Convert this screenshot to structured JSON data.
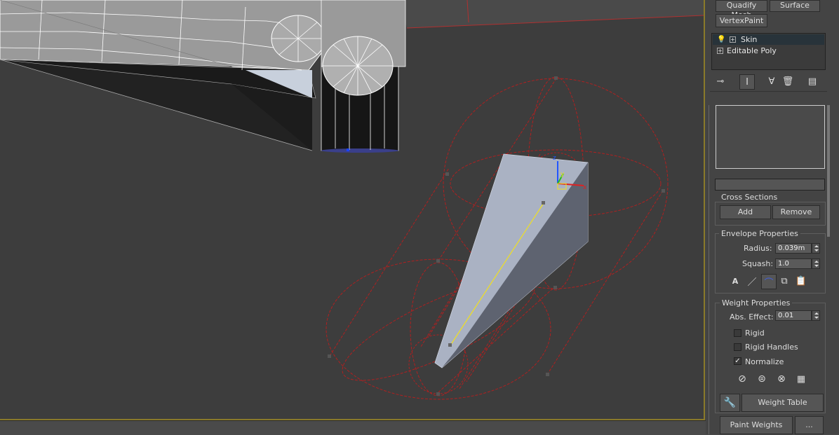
{
  "modifier_buttons": {
    "quadify": "Quadify Mesh",
    "surface": "Surface",
    "vertexpaint": "VertexPaint"
  },
  "stack": {
    "items": [
      {
        "label": "Skin",
        "selected": true,
        "icon": "lightbulb-icon"
      },
      {
        "label": "Editable Poly",
        "selected": false,
        "icon": "expand-plus-icon"
      }
    ]
  },
  "stack_tools": [
    "pin-stack-icon",
    "show-end-result-icon",
    "make-unique-icon",
    "remove-modifier-icon",
    "configure-sets-icon"
  ],
  "cross_sections": {
    "title": "Cross Sections",
    "add": "Add",
    "remove": "Remove"
  },
  "envelope": {
    "title": "Envelope Properties",
    "radius_label": "Radius:",
    "radius_value": "0.039m",
    "squash_label": "Squash:",
    "squash_value": "1.0",
    "icons": [
      "absolute-relative-icon",
      "envelope-visibility-icon",
      "falloff-icon",
      "copy-envelope-icon",
      "paste-envelope-icon"
    ]
  },
  "weight": {
    "title": "Weight Properties",
    "abs_label": "Abs. Effect:",
    "abs_value": "0.01",
    "rigid": {
      "label": "Rigid",
      "checked": false
    },
    "rigid_handles": {
      "label": "Rigid Handles",
      "checked": false
    },
    "normalize": {
      "label": "Normalize",
      "checked": true
    },
    "icons": [
      "exclude-verts-icon",
      "include-verts-icon",
      "select-excluded-icon",
      "bake-weights-icon"
    ],
    "weight_tool_icon": "wrench-icon",
    "weight_table": "Weight Table",
    "paint_weights": "Paint Weights",
    "paint_options": "...",
    "normalize_check_glyph": "✓"
  },
  "colors": {
    "envelope": "#b02020",
    "bone": "#f0e020",
    "viewport_bg": "#3d3d3d",
    "viewport_border": "#8a7a2a"
  }
}
